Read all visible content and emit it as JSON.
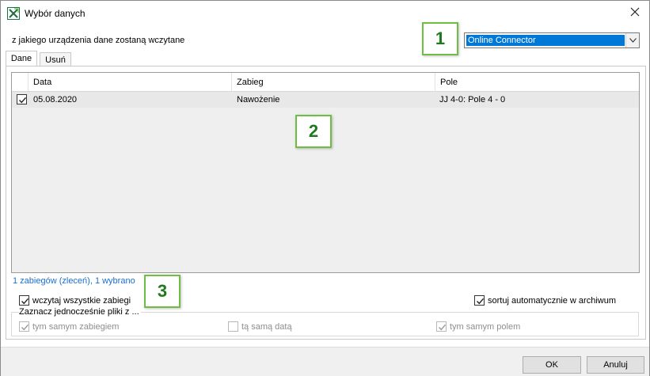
{
  "window": {
    "title": "Wybór danych",
    "icon": "excel-app-icon",
    "close_icon": "close-icon"
  },
  "source": {
    "label": "z jakiego urządzenia dane zostaną wczytane",
    "selected": "Online Connector"
  },
  "tabs": [
    {
      "label": "Dane",
      "active": true
    },
    {
      "label": "Usuń",
      "active": false
    }
  ],
  "grid": {
    "columns": [
      "Data",
      "Zabieg",
      "Pole"
    ],
    "rows": [
      {
        "checked": true,
        "data": "05.08.2020",
        "zabieg": "Nawożenie",
        "pole": "JJ 4-0: Pole 4 - 0"
      }
    ]
  },
  "status": {
    "count_text": "1 zabiegów (zleceń), 1 wybrano"
  },
  "options": {
    "load_all": {
      "label": "wczytaj wszystkie zabiegi",
      "checked": true
    },
    "sort_auto": {
      "label": "sortuj automatycznie w archiwum",
      "checked": true
    },
    "group_title": "Zaznacz jednocześnie pliki z ...",
    "same_treatment": {
      "label": "tym samym zabiegiem",
      "checked": true,
      "enabled": false
    },
    "same_date": {
      "label": "tą samą datą",
      "checked": false,
      "enabled": false
    },
    "same_field": {
      "label": "tym samym polem",
      "checked": true,
      "enabled": false
    }
  },
  "callouts": [
    "1",
    "2",
    "3"
  ],
  "buttons": {
    "ok": "OK",
    "cancel": "Anuluj"
  },
  "colors": {
    "selection": "#0078d7",
    "callout_border": "#6cbe45",
    "callout_text": "#1f7a1f",
    "link": "#1a6fd1"
  }
}
